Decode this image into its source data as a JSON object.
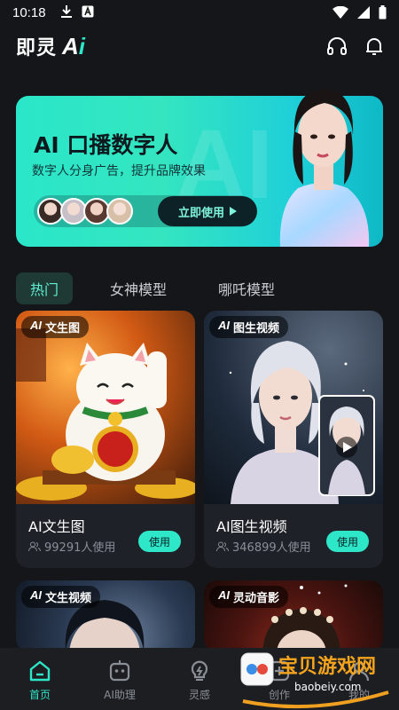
{
  "status": {
    "time": "10:18"
  },
  "header": {
    "logo_cn": "即灵",
    "logo_ai_a": "A",
    "logo_ai_i": "i"
  },
  "banner": {
    "title": "AI 口播数字人",
    "subtitle": "数字人分身广告，提升品牌效果",
    "watermark": "AI",
    "button_label": "立即使用"
  },
  "tabs": [
    {
      "label": "热门"
    },
    {
      "label": "女神模型"
    },
    {
      "label": "哪吒模型"
    }
  ],
  "cards": [
    {
      "tag_ai": "AI",
      "tag_label": "文生图",
      "title": "AI文生图",
      "usage": "99291人使用",
      "button": "使用"
    },
    {
      "tag_ai": "AI",
      "tag_label": "图生视频",
      "title": "AI图生视频",
      "usage": "346899人使用",
      "button": "使用"
    },
    {
      "tag_ai": "AI",
      "tag_label": "文生视频"
    },
    {
      "tag_ai": "AI",
      "tag_label": "灵动音影"
    }
  ],
  "nav": [
    {
      "label": "首页"
    },
    {
      "label": "AI助理"
    },
    {
      "label": "灵感"
    },
    {
      "label": "创作"
    },
    {
      "label": "我的"
    }
  ],
  "watermark": {
    "brand": "宝贝游戏网",
    "url": "baobeiy.com"
  },
  "colors": {
    "accent": "#2ee6c8",
    "background": "#14161a",
    "card": "#1e2127"
  }
}
